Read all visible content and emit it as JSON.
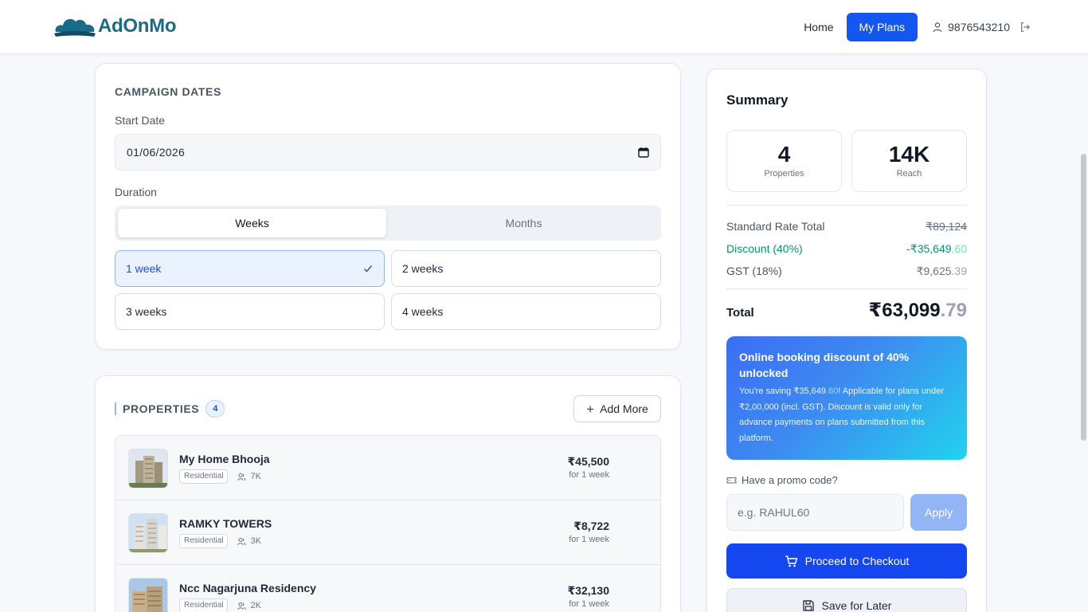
{
  "brand": {
    "name": "AdOnMo",
    "color": "#1a6b8a"
  },
  "nav": {
    "home": "Home",
    "my_plans": "My Plans",
    "user_phone": "9876543210",
    "accent": "#1456f0"
  },
  "campaign": {
    "section_title": "CAMPAIGN DATES",
    "start_label": "Start Date",
    "start_value": "01/06/2026",
    "duration_label": "Duration",
    "tabs": [
      "Weeks",
      "Months"
    ],
    "active_tab": "Weeks",
    "options": [
      "1 week",
      "2 weeks",
      "3 weeks",
      "4 weeks"
    ],
    "selected_option": "1 week"
  },
  "properties": {
    "title": "PROPERTIES",
    "count": "4",
    "add_more": "Add More",
    "items": [
      {
        "name": "My Home Bhooja",
        "type": "Residential",
        "reach": "7K",
        "price": "₹45,500",
        "per": "for 1 week"
      },
      {
        "name": "RAMKY TOWERS",
        "type": "Residential",
        "reach": "3K",
        "price": "₹8,722",
        "per": "for 1 week"
      },
      {
        "name": "Ncc Nagarjuna Residency",
        "type": "Residential",
        "reach": "2K",
        "price": "₹32,130",
        "per": "for 1 week"
      }
    ]
  },
  "summary": {
    "title": "Summary",
    "properties_num": "4",
    "properties_label": "Properties",
    "reach_num": "14K",
    "reach_label": "Reach",
    "standard_label": "Standard Rate Total",
    "standard_value": "₹89,124",
    "discount_label": "Discount (40%)",
    "discount_main": "-₹35,649",
    "discount_cents": ".60",
    "gst_label": "GST (18%)",
    "gst_main": "₹9,625",
    "gst_cents": ".39",
    "total_label": "Total",
    "total_main": "₹63,099",
    "total_cents": ".79",
    "promo_heading": "Online booking discount of 40% unlocked",
    "promo_text_1": "You're saving ₹35,649",
    "promo_text_cents": ".60",
    "promo_text_2": "! Applicable for plans under ₹2,00,000 (incl. GST). Discount is valid only for advance payments on plans submitted from this platform.",
    "promo_question": "Have a promo code?",
    "promo_placeholder": "e.g. RAHUL60",
    "apply_label": "Apply",
    "checkout_label": "Proceed to Checkout",
    "save_label": "Save for Later"
  },
  "icons": [
    "user-icon",
    "logout-icon",
    "calendar-icon",
    "check-icon",
    "plus-icon",
    "users-icon",
    "ticket-icon",
    "cart-icon",
    "save-icon"
  ]
}
